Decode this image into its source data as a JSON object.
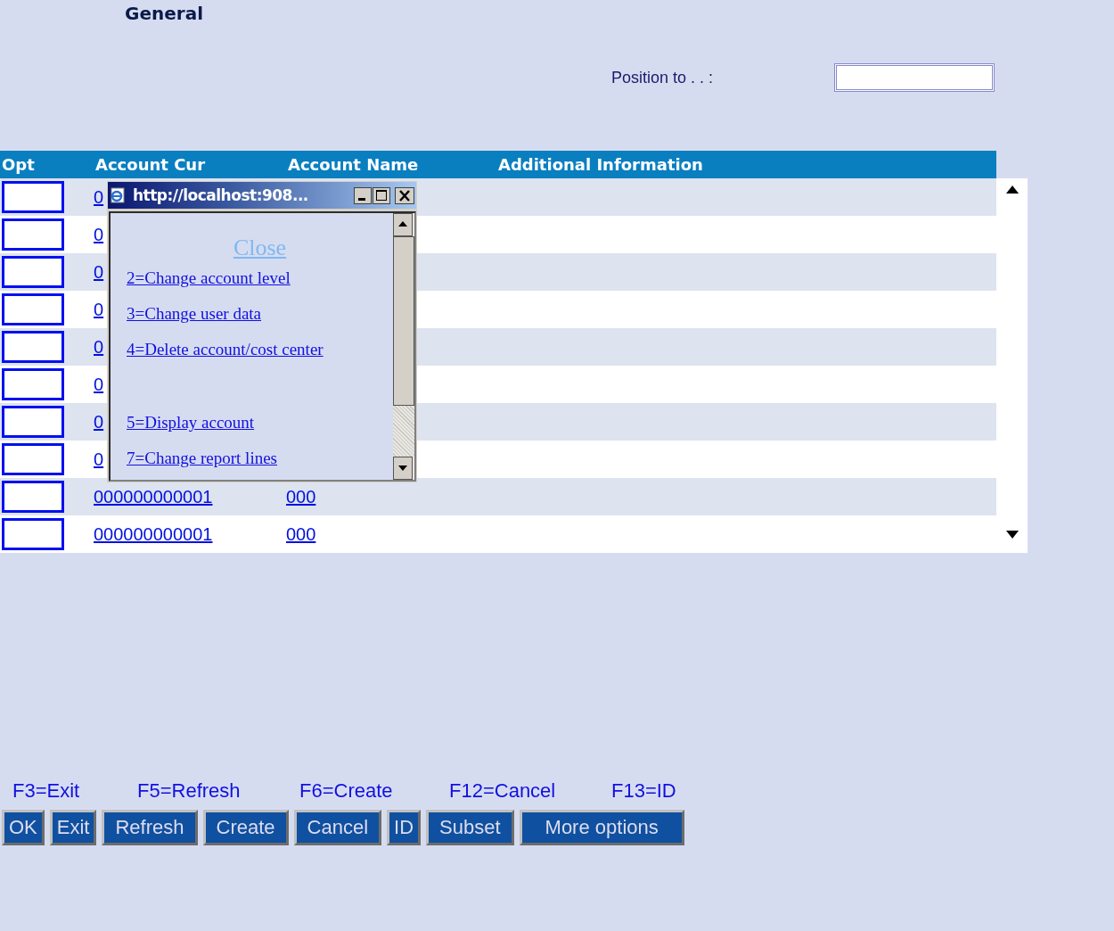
{
  "title": "General",
  "position": {
    "label": "Position to . . :"
  },
  "table": {
    "columns": [
      "Opt",
      "Account Cur",
      "Account Name",
      "Additional Information"
    ],
    "rows": [
      {
        "account_cur": "0",
        "account_name": ""
      },
      {
        "account_cur": "0",
        "account_name": ""
      },
      {
        "account_cur": "0",
        "account_name": ""
      },
      {
        "account_cur": "0",
        "account_name": ""
      },
      {
        "account_cur": "0",
        "account_name": ""
      },
      {
        "account_cur": "0",
        "account_name": ""
      },
      {
        "account_cur": "0",
        "account_name": ""
      },
      {
        "account_cur": "0",
        "account_name": ""
      },
      {
        "account_cur": "000000000001",
        "account_name": "000"
      },
      {
        "account_cur": "000000000001",
        "account_name": "000"
      }
    ]
  },
  "popup": {
    "title": "http://localhost:908...",
    "close": "Close",
    "options": [
      "2=Change account level",
      "3=Change user data",
      "4=Delete account/cost center",
      "5=Display account",
      "7=Change report lines"
    ]
  },
  "function_keys": [
    "F3=Exit",
    "F5=Refresh",
    "F6=Create",
    "F12=Cancel",
    "F13=ID"
  ],
  "buttons": [
    "OK",
    "Exit",
    "Refresh",
    "Create",
    "Cancel",
    "ID",
    "Subset",
    "More options"
  ]
}
